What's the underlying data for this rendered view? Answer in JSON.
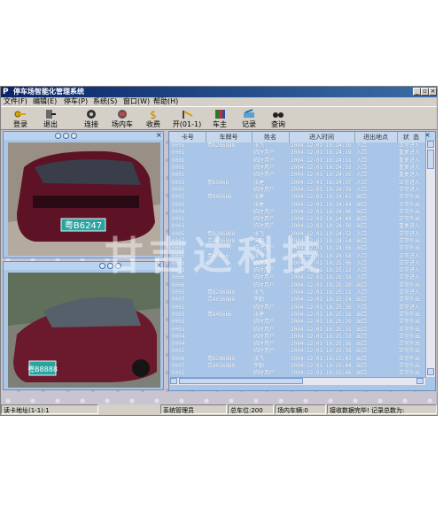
{
  "window": {
    "title": "停车场智能化管理系统",
    "app_icon": "P"
  },
  "menu": [
    "文件(F)",
    "编辑(E)",
    "停车(P)",
    "系统(S)",
    "窗口(W)",
    "帮助(H)"
  ],
  "toolbar": [
    {
      "label": "登录",
      "icon": "key-icon"
    },
    {
      "label": "退出",
      "icon": "exit-icon"
    },
    {
      "label": "连接",
      "icon": "connect-icon"
    },
    {
      "label": "场内车",
      "icon": "car-icon"
    },
    {
      "label": "收费",
      "icon": "money-icon"
    },
    {
      "label": "开(01-1)",
      "icon": "gate-icon"
    },
    {
      "label": "车主",
      "icon": "book-icon"
    },
    {
      "label": "记录",
      "icon": "record-icon"
    },
    {
      "label": "查询",
      "icon": "binoculars-icon"
    }
  ],
  "plates": {
    "top": "粤B6247",
    "bottom": "粤B8888"
  },
  "table": {
    "headers": [
      "卡号",
      "车牌号",
      "姓名",
      "进入时间",
      "进出地点",
      "状 态"
    ],
    "rows": [
      [
        "0005",
        "粤B286888",
        "张飞",
        "2004-12-01 18:24:26",
        "入口",
        "正常进入"
      ],
      [
        "0001",
        "",
        "临时用户",
        "2004-12-01 18:24:29",
        "入口",
        "重复进入"
      ],
      [
        "0001",
        "",
        "临时用户",
        "2004-12-01 18:24:31",
        "入口",
        "重复进入"
      ],
      [
        "0001",
        "",
        "临时用户",
        "2004-12-01 18:24:33",
        "入口",
        "重复进入"
      ],
      [
        "0001",
        "",
        "临时用户",
        "2004-12-01 18:24:35",
        "入口",
        "重复进入"
      ],
      [
        "0003",
        "粤B5666",
        "张建",
        "2004-12-01 18:24:37",
        "入口",
        "正常进入"
      ],
      [
        "0005",
        "",
        "临时用户",
        "2004-12-01 18:24:39",
        "入口",
        "正常进入"
      ],
      [
        "0007",
        "粤B45666",
        "张建",
        "2004-12-01 18:24:41",
        "出口",
        "正常外出"
      ],
      [
        "0003",
        "",
        "张建",
        "2004-12-01 18:24:44",
        "出口",
        "正常外出"
      ],
      [
        "0004",
        "",
        "临时用户",
        "2004-12-01 18:24:46",
        "出口",
        "正常外出"
      ],
      [
        "0001",
        "",
        "临时用户",
        "2004-12-01 18:24:48",
        "出口",
        "正常外出"
      ],
      [
        "0003",
        "",
        "临时用户",
        "2004-12-01 18:24:50",
        "出口",
        "重复进入"
      ],
      [
        "0005",
        "粤B286888",
        "张飞",
        "2004-12-01 18:24:52",
        "入口",
        "正常进入"
      ],
      [
        "0007",
        "京A016888",
        "李勤",
        "2004-12-01 18:24:54",
        "出口",
        "正常外出"
      ],
      [
        "0001",
        "",
        "临时用户",
        "2004-12-01 18:24:56",
        "出口",
        "正常外出"
      ],
      [
        "0005",
        "粤B5666",
        "张飞",
        "2004-12-01 18:24:58",
        "入口",
        "正常进入"
      ],
      [
        "0003",
        "",
        "临时用户",
        "2004-12-01 18:25:06",
        "入口",
        "正常进入"
      ],
      [
        "0003",
        "",
        "临时用户",
        "2004-12-01 18:25:12",
        "入口",
        "正常进入"
      ],
      [
        "0006",
        "",
        "临时用户",
        "2004-12-01 18:25:18",
        "入口",
        "正常进入"
      ],
      [
        "0006",
        "",
        "临时用户",
        "2004-12-01 18:25:20",
        "出口",
        "正常外出"
      ],
      [
        "0005",
        "粤B286888",
        "张飞",
        "2004-12-01 18:25:22",
        "入口",
        "正常进入"
      ],
      [
        "0007",
        "京A016888",
        "李勤",
        "2004-12-01 18:25:24",
        "出口",
        "正常外出"
      ],
      [
        "0001",
        "",
        "临时用户",
        "2004-12-01 18:25:26",
        "入口",
        "正常进入"
      ],
      [
        "0003",
        "粤B45666",
        "张建",
        "2004-12-01 18:25:28",
        "出口",
        "正常外出"
      ],
      [
        "0003",
        "",
        "临时用户",
        "2004-12-01 18:25:29",
        "出口",
        "正常外出"
      ],
      [
        "0003",
        "",
        "临时用户",
        "2004-12-01 18:25:31",
        "出口",
        "正常外出"
      ],
      [
        "0004",
        "",
        "临时用户",
        "2004-12-01 18:25:33",
        "出口",
        "正常外出"
      ],
      [
        "0004",
        "",
        "临时用户",
        "2004-12-01 18:25:36",
        "出口",
        "正常外出"
      ],
      [
        "0001",
        "",
        "临时用户",
        "2004-12-01 18:25:38",
        "出口",
        "正常外出"
      ],
      [
        "0006",
        "粤B286888",
        "张飞",
        "2004-12-01 18:25:42",
        "出口",
        "正常外出"
      ],
      [
        "0007",
        "京A016888",
        "李勤",
        "2004-12-01 18:25:44",
        "出口",
        "正常外出"
      ],
      [
        "0001",
        "",
        "临时用户",
        "2004-12-01 18:25:46",
        "出口",
        "正常外出"
      ]
    ]
  },
  "status": {
    "addr": "读卡地址(1-1):1",
    "user": "系统管理员",
    "total": "总车位:200",
    "inside": "场内车辆:0",
    "recv": "接收数据完毕! 记录总数为:"
  },
  "watermark": "甘吉达科技",
  "colors": {
    "titlebar": "#0a246a",
    "panel": "#a9c6e8",
    "car": "#6b1a2e"
  }
}
